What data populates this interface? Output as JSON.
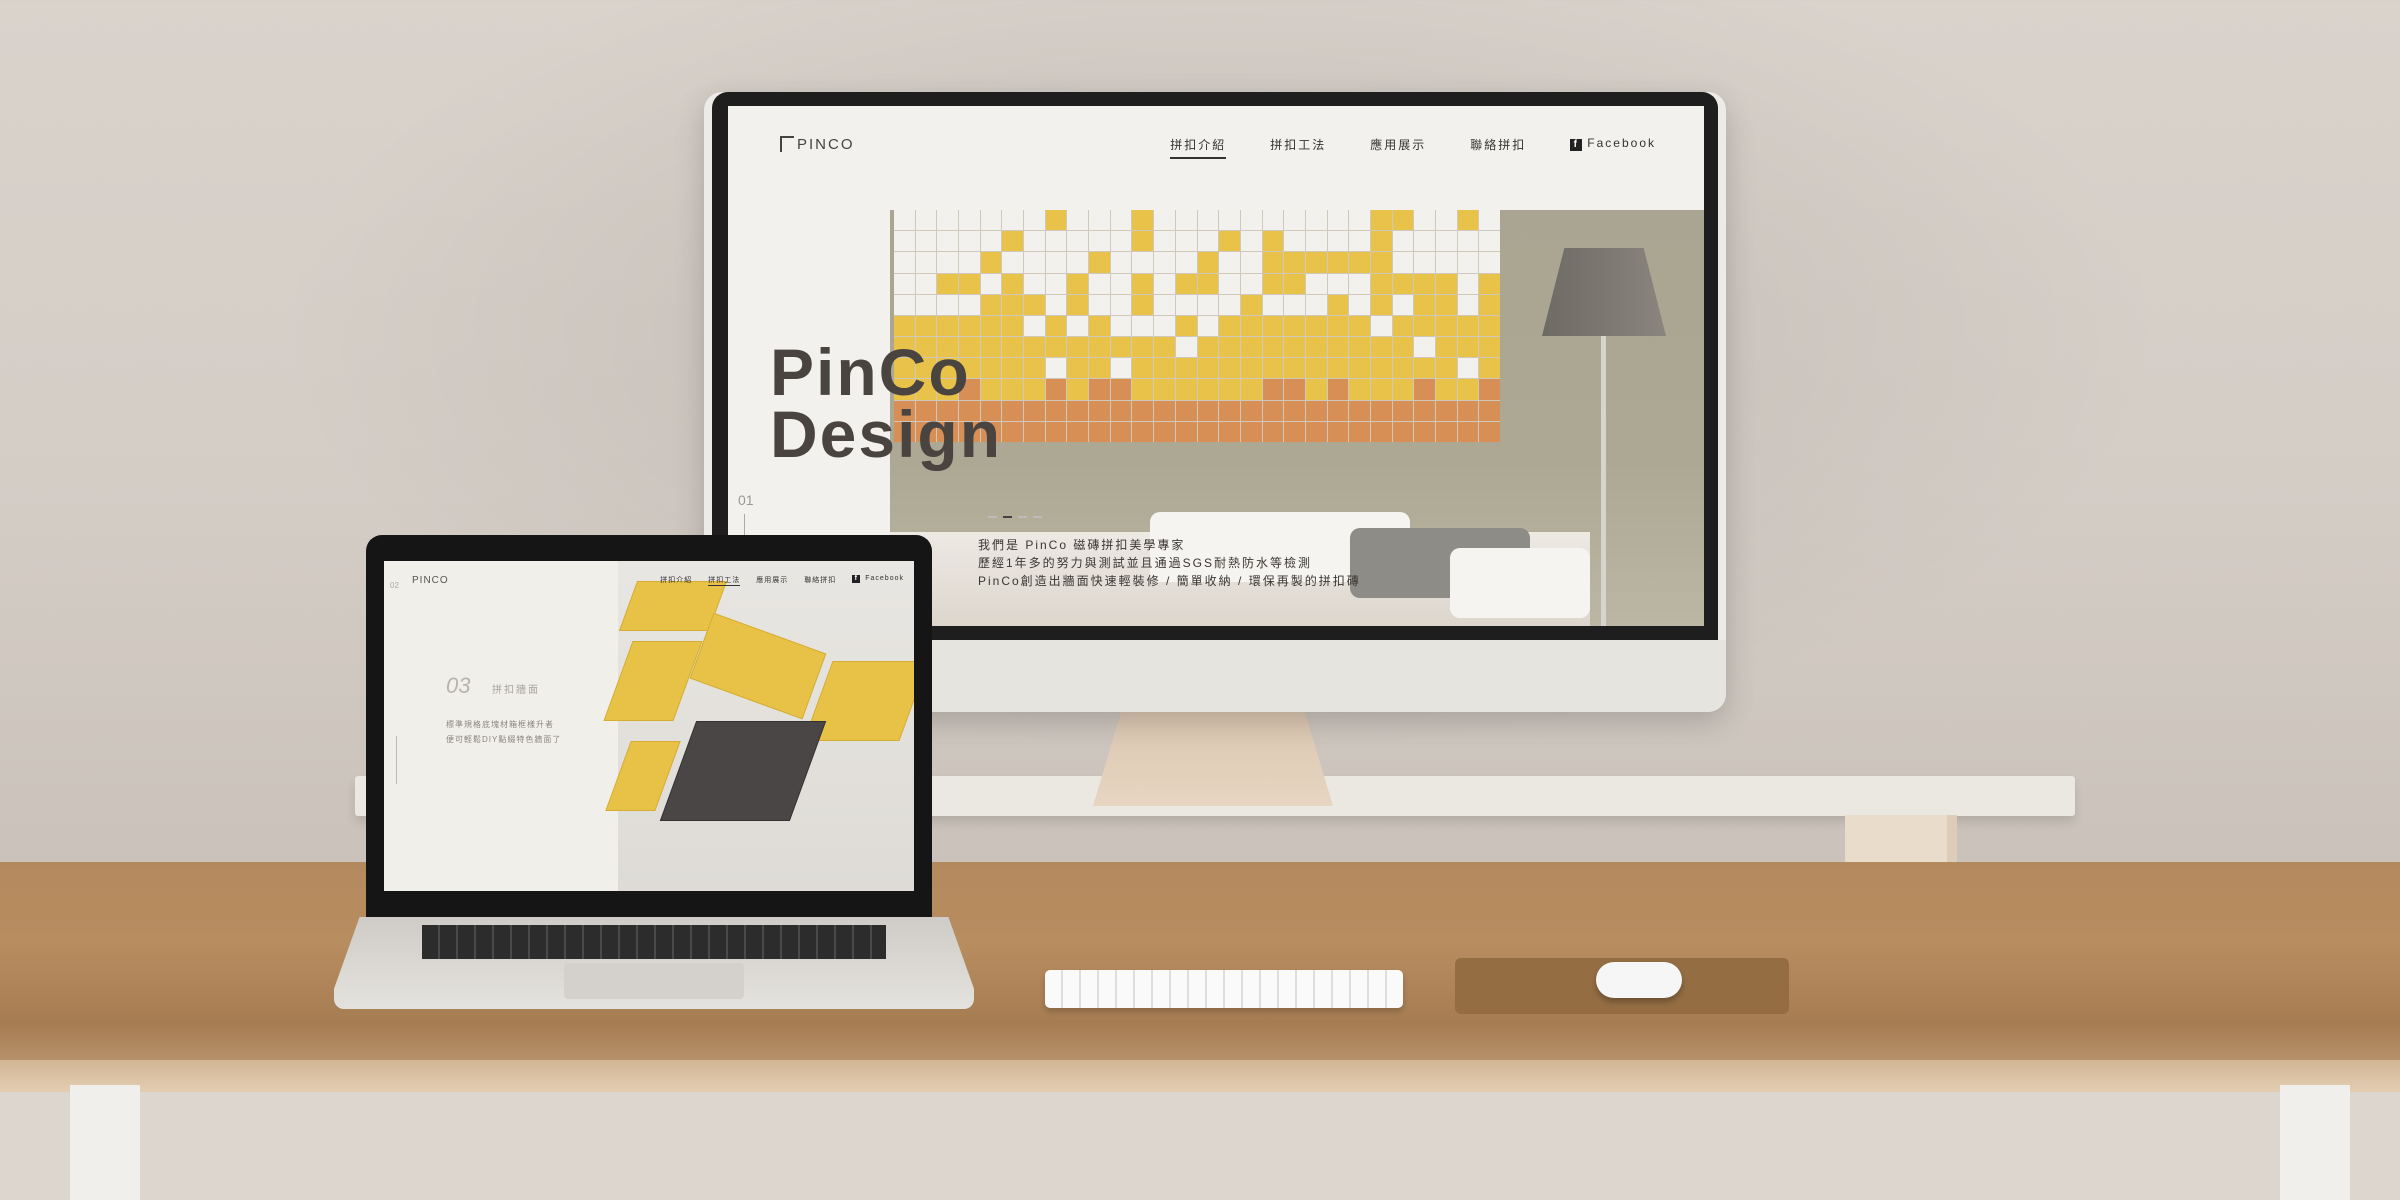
{
  "desktop": {
    "logo": "PINCO",
    "nav": [
      "拼扣介紹",
      "拼扣工法",
      "應用展示",
      "聯絡拼扣"
    ],
    "facebook_label": "Facebook",
    "hero_title_line1": "PinCo",
    "hero_title_line2": "Design",
    "slide_number": "01",
    "hero_text": [
      "我們是 PinCo 磁磚拼扣美學專家",
      "歷經1年多的努力與測試並且通過SGS耐熱防水等檢測",
      "PinCo創造出牆面快速輕裝修 / 簡單收納 / 環保再製的拼扣磚"
    ]
  },
  "laptop": {
    "logo": "PINCO",
    "side_number": "02",
    "nav": [
      "拼扣介紹",
      "拼扣工法",
      "應用展示",
      "聯絡拼扣"
    ],
    "facebook_label": "Facebook",
    "section_number": "03",
    "section_heading": "拼扣牆面",
    "section_text": [
      "標準規格底塊材箱框樣升者",
      "便可輕鬆DIY點綴特色牆面了"
    ]
  },
  "colors": {
    "mosaic_yellow": "#e9c24a",
    "mosaic_orange": "#d88f55",
    "mosaic_white": "#f3f1ee",
    "desk_wood": "#b38a5e",
    "hero_text": "#4a4441"
  },
  "icons": {
    "apple": "apple-logo-icon",
    "facebook": "facebook-icon"
  }
}
